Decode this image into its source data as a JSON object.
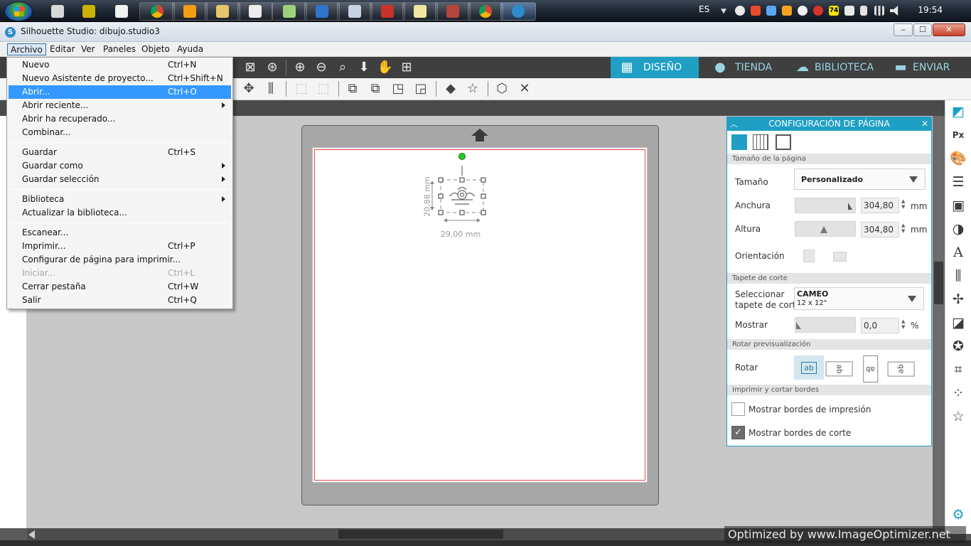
{
  "taskbar": {
    "language": "ES",
    "clock": "19:54",
    "battery_badge": "74",
    "start_icon": "windows-start-orb-icon"
  },
  "window": {
    "title": "Silhouette Studio: dibujo.studio3",
    "minimize_label": "‒",
    "maximize_label": "☐",
    "close_label": "✕"
  },
  "menubar": {
    "items": [
      "Archivo",
      "Editar",
      "Ver",
      "Paneles",
      "Objeto",
      "Ayuda"
    ]
  },
  "archivo_menu": {
    "items": [
      {
        "label": "Nuevo",
        "shortcut": "Ctrl+N"
      },
      {
        "label": "Nuevo Asistente de proyecto...",
        "shortcut": "Ctrl+Shift+N"
      },
      {
        "label": "Abrir...",
        "shortcut": "Ctrl+O",
        "highlighted": true
      },
      {
        "label": "Abrir reciente...",
        "shortcut": "",
        "submenu": true
      },
      {
        "label": "Abrir ha recuperado...",
        "shortcut": ""
      },
      {
        "label": "Combinar...",
        "shortcut": ""
      },
      {
        "label": "Guardar",
        "shortcut": "Ctrl+S"
      },
      {
        "label": "Guardar como",
        "shortcut": "",
        "submenu": true
      },
      {
        "label": "Guardar selección",
        "shortcut": "",
        "submenu": true
      },
      {
        "label": "Biblioteca",
        "shortcut": "",
        "submenu": true
      },
      {
        "label": "Actualizar la biblioteca...",
        "shortcut": ""
      },
      {
        "label": "Escanear...",
        "shortcut": ""
      },
      {
        "label": "Imprimir...",
        "shortcut": "Ctrl+P"
      },
      {
        "label": "Configurar de página para imprimir...",
        "shortcut": ""
      },
      {
        "label": "Iniciar...",
        "shortcut": "Ctrl+L",
        "disabled": true
      },
      {
        "label": "Cerrar pestaña",
        "shortcut": "Ctrl+W"
      },
      {
        "label": "Salir",
        "shortcut": "Ctrl+Q"
      }
    ]
  },
  "nav_tabs": {
    "diseno": "DISEÑO",
    "tienda": "TIENDA",
    "biblioteca": "BIBLIOTECA",
    "enviar": "ENVIAR"
  },
  "canvas": {
    "width_dim": "29,00 mm",
    "height_dim": "20,88 mm"
  },
  "page_panel": {
    "title": "CONFIGURACIÓN DE PÁGINA",
    "section_size": "Tamaño de la página",
    "size_label": "Tamaño",
    "size_value": "Personalizado",
    "width_label": "Anchura",
    "width_value": "304,80",
    "height_label": "Altura",
    "height_value": "304,80",
    "unit": "mm",
    "orientation_label": "Orientación",
    "section_mat": "Tapete de corte",
    "mat_label_1": "Seleccionar",
    "mat_label_2": "tapete de corte",
    "mat_value": "CAMEO",
    "mat_sub": "12 x 12\"",
    "show_label": "Mostrar",
    "show_value": "0,0",
    "show_unit": "%",
    "section_rotate": "Rotar previsualización",
    "rotate_label": "Rotar",
    "rotate_glyph": "ab",
    "section_print": "Imprimir y cortar bordes",
    "print_borders_label": "Mostrar bordes de impresión",
    "print_borders_checked": false,
    "cut_borders_label": "Mostrar bordes de corte",
    "cut_borders_checked": true
  },
  "watermark": "Optimized by www.ImageOptimizer.net",
  "colors": {
    "accent": "#1f9fc4",
    "menu_highlight": "#3399ff",
    "cut_line": "#e24b4b"
  }
}
